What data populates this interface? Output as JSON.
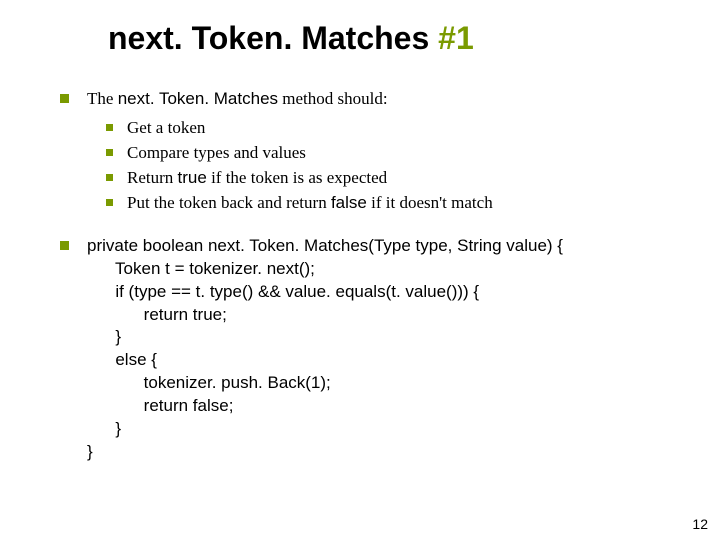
{
  "title": {
    "part1": "next. Token. Matches ",
    "part2": "#1"
  },
  "intro": {
    "prefix": "The ",
    "method": "next. Token. Matches",
    "suffix": " method should:"
  },
  "bullets": [
    "Get a token",
    "Compare types and values",
    {
      "pre": "Return ",
      "kw": "true",
      "post": " if the token is as expected"
    },
    {
      "pre": "Put the token back and return ",
      "kw": "false",
      "post": " if it doesn't match"
    }
  ],
  "code": {
    "l0": "private boolean next. Token. Matches(Type type, String value) {",
    "l1": "      Token t = tokenizer. next();",
    "l2": "      if (type == t. type() && value. equals(t. value())) {",
    "l3": "            return true;",
    "l4": "      }",
    "l5": "      else {",
    "l6": "            tokenizer. push. Back(1);",
    "l7": "            return false;",
    "l8": "      }",
    "l9": "}"
  },
  "page": "12"
}
